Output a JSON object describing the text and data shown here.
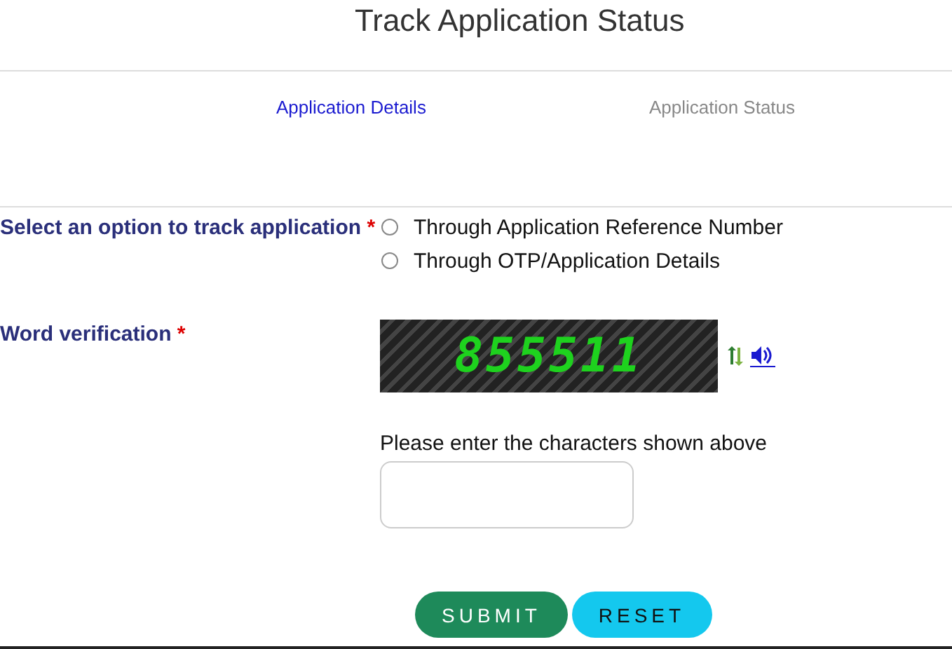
{
  "title": "Track Application Status",
  "tabs": [
    {
      "label": "Application Details",
      "selected": true
    },
    {
      "label": "Application Status",
      "selected": false
    }
  ],
  "track_option": {
    "label": "Select an option to track application",
    "required_mark": "*",
    "options": [
      {
        "label": "Through Application Reference Number",
        "selected": false
      },
      {
        "label": "Through OTP/Application Details",
        "selected": false
      }
    ]
  },
  "word_verification": {
    "label": "Word verification",
    "required_mark": "*",
    "captcha": "855511",
    "prompt": "Please enter the characters shown above"
  },
  "buttons": [
    {
      "label": "SUBMIT",
      "kind": "submit"
    },
    {
      "label": "RESET",
      "kind": "reset"
    }
  ]
}
